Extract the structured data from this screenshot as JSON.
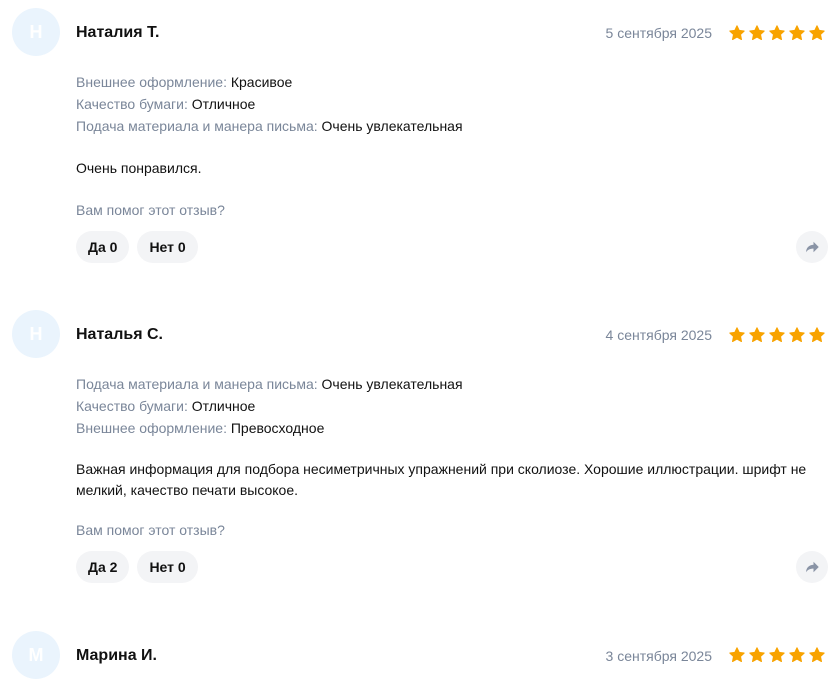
{
  "colors": {
    "star": "#f8a300",
    "muted_text": "#7a8699",
    "avatar_bg": "#eaf4fd",
    "button_bg": "#f3f4f6"
  },
  "helpful_question": "Вам помог этот отзыв?",
  "reviews": [
    {
      "initial": "Н",
      "author": "Наталия Т.",
      "date": "5 сентября 2025",
      "rating": 5,
      "attributes": [
        {
          "name": "Внешнее оформление: ",
          "value": "Красивое"
        },
        {
          "name": "Качество бумаги: ",
          "value": "Отличное"
        },
        {
          "name": "Подача материала и манера письма: ",
          "value": "Очень увлекательная"
        }
      ],
      "text": "Очень понравился.",
      "yes_label": "Да 0",
      "no_label": "Нет 0",
      "share_icon": "share-icon"
    },
    {
      "initial": "Н",
      "author": "Наталья С.",
      "date": "4 сентября 2025",
      "rating": 5,
      "attributes": [
        {
          "name": "Подача материала и манера письма: ",
          "value": "Очень увлекательная"
        },
        {
          "name": "Качество бумаги: ",
          "value": "Отличное"
        },
        {
          "name": "Внешнее оформление: ",
          "value": "Превосходное"
        }
      ],
      "text": "Важная информация для подбора несиметричных упражнений при сколиозе. Хорошие иллюстрации. шрифт не мелкий, качество печати высокое.",
      "yes_label": "Да 2",
      "no_label": "Нет 0",
      "share_icon": "share-icon"
    },
    {
      "initial": "М",
      "author": "Марина И.",
      "date": "3 сентября 2025",
      "rating": 5
    }
  ]
}
